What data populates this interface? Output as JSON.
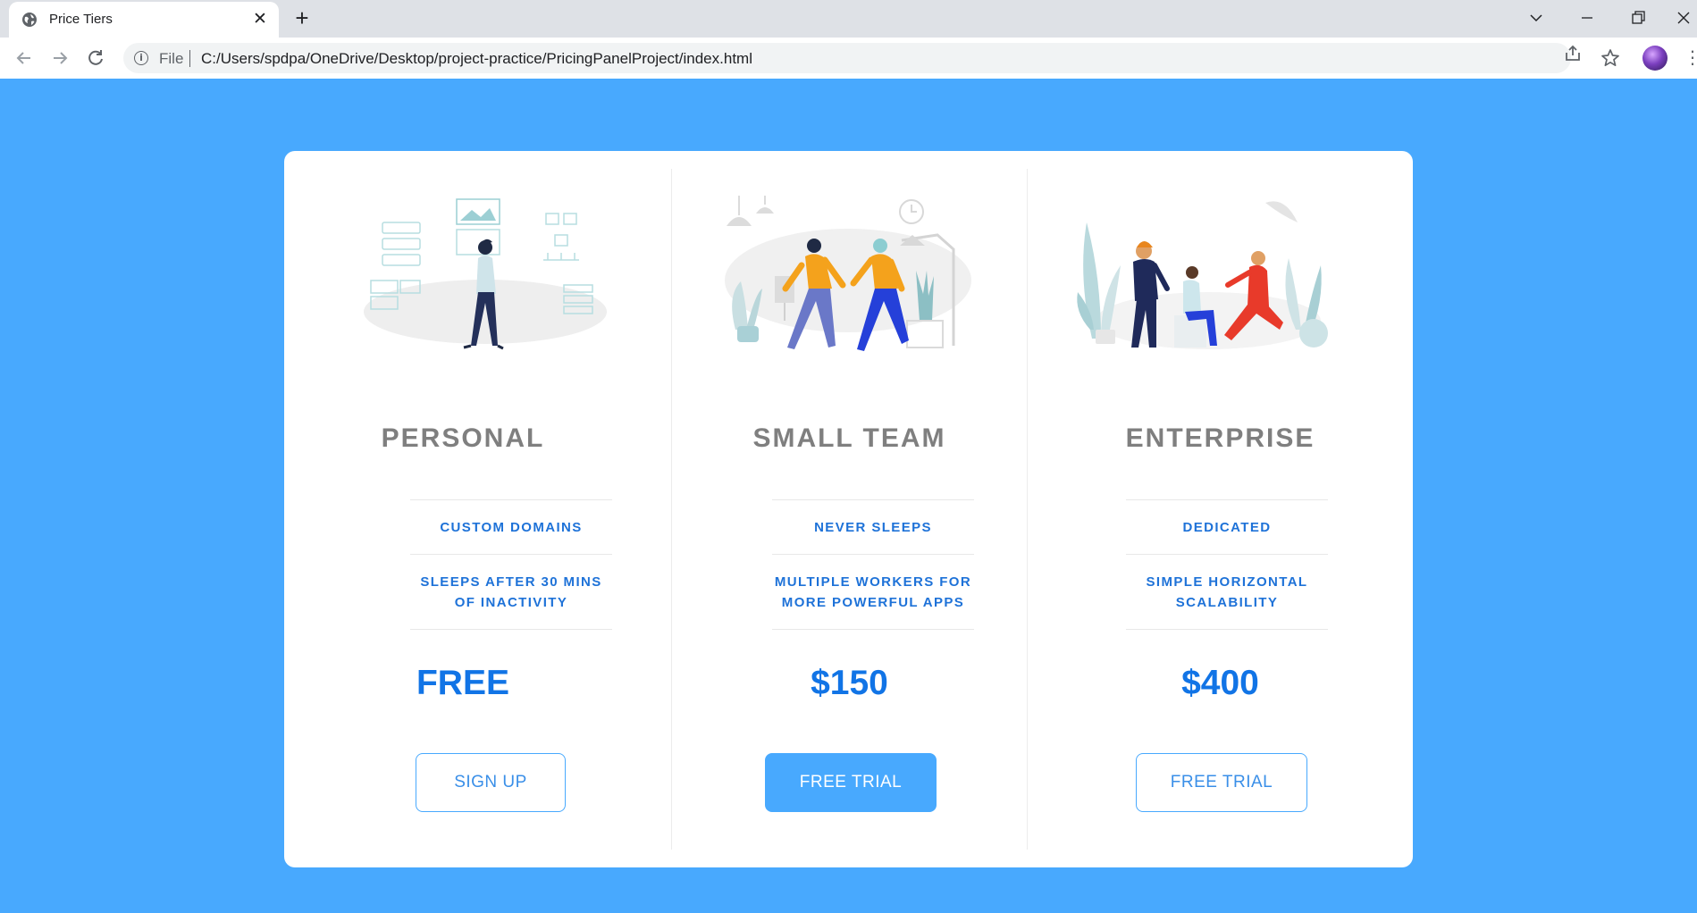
{
  "browser": {
    "tab_title": "Price Tiers",
    "close_glyph": "✕",
    "new_tab_glyph": "+",
    "file_label": "File",
    "url": "C:/Users/spdpa/OneDrive/Desktop/project-practice/PricingPanelProject/index.html",
    "icons": [
      "globe-icon",
      "close-icon",
      "plus-icon",
      "chevron-down-icon",
      "minimize-icon",
      "restore-icon",
      "close-window-icon",
      "back-arrow-icon",
      "forward-arrow-icon",
      "reload-icon",
      "info-icon",
      "share-icon",
      "star-icon",
      "avatar",
      "kebab-menu-icon"
    ]
  },
  "colors": {
    "page_background": "#48a9fe",
    "panel_background": "#ffffff",
    "tier_name": "#7f7f7f",
    "feature_text": "#1e72d8",
    "price_text": "#1174e6",
    "button_accent": "#48a9fe"
  },
  "tiers": [
    {
      "name": "PERSONAL",
      "features": [
        "CUSTOM DOMAINS",
        "SLEEPS AFTER 30 MINS OF INACTIVITY"
      ],
      "price": "FREE",
      "button": "SIGN UP",
      "button_style": "outline",
      "illustration": "person-presenting-illustration"
    },
    {
      "name": "SMALL TEAM",
      "features": [
        "NEVER SLEEPS",
        "MULTIPLE WORKERS FOR MORE POWERFUL APPS"
      ],
      "price": "$150",
      "button": "FREE TRIAL",
      "button_style": "filled",
      "illustration": "team-walking-illustration"
    },
    {
      "name": "ENTERPRISE",
      "features": [
        "DEDICATED",
        "SIMPLE HORIZONTAL SCALABILITY"
      ],
      "price": "$400",
      "button": "FREE TRIAL",
      "button_style": "outline",
      "illustration": "team-meeting-illustration"
    }
  ]
}
